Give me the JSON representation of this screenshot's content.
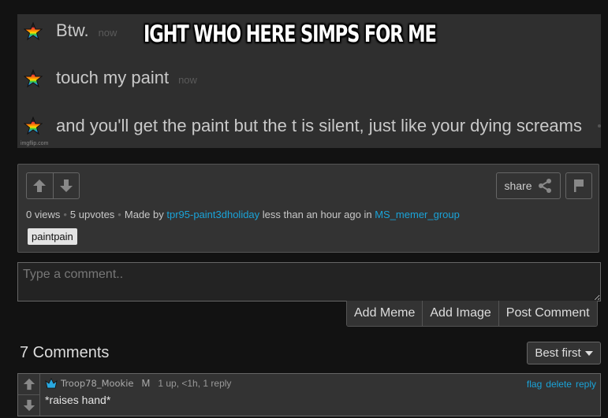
{
  "meme": {
    "caption": "IGHT WHO HERE SIMPS FOR ME",
    "watermark": "imgflip.com",
    "messages": [
      {
        "text": "Btw.",
        "time": "now"
      },
      {
        "text": "touch my paint",
        "time": "now"
      },
      {
        "text": "and you'll get the paint but the t is silent, just like your dying screams",
        "time": ""
      }
    ]
  },
  "post": {
    "views": "0 views",
    "upvotes": "5 upvotes",
    "made_by_label": "Made by",
    "author": "tpr95-paint3dholiday",
    "time_text": "less than an hour ago in",
    "stream": "MS_memer_group",
    "share_label": "share",
    "tags": [
      "paintpain"
    ]
  },
  "comment_form": {
    "placeholder": "Type a comment..",
    "buttons": [
      "Add Meme",
      "Add Image",
      "Post Comment"
    ]
  },
  "comments_section": {
    "title": "7 Comments",
    "sort_selected": "Best first",
    "comments": [
      {
        "user": "Troop78_Mookie",
        "badge": "M",
        "stats": "1 up, <1h, 1 reply",
        "text": "*raises hand*",
        "links": [
          "flag",
          "delete",
          "reply"
        ]
      }
    ]
  },
  "colors": {
    "link": "#1aa3d8",
    "background": "#121212",
    "panel": "#333333",
    "crown": "#2aa8e0"
  }
}
